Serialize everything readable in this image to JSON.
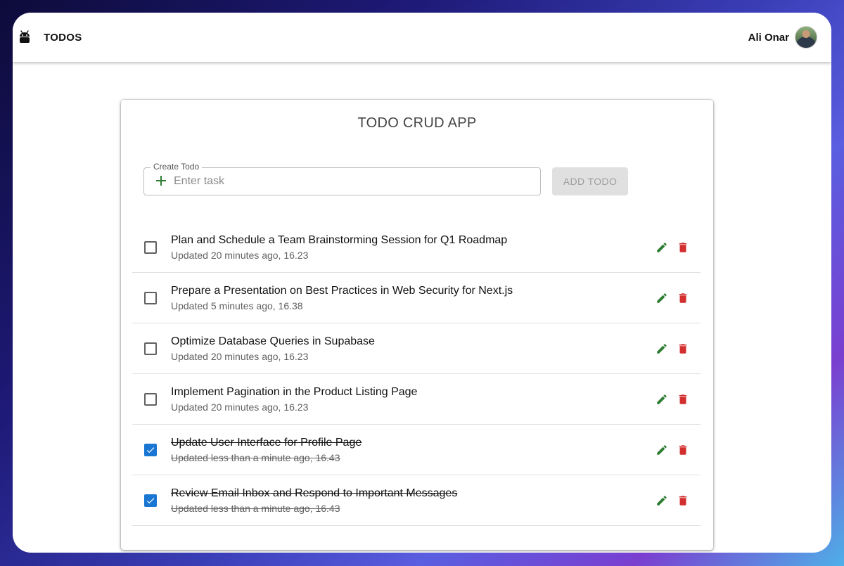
{
  "app": {
    "title": "TODOS",
    "user_name": "Ali Onar"
  },
  "card": {
    "title": "TODO CRUD APP"
  },
  "create": {
    "label": "Create Todo",
    "placeholder": "Enter task",
    "button_label": "ADD TODO"
  },
  "todos": [
    {
      "title": "Plan and Schedule a Team Brainstorming Session for Q1 Roadmap",
      "updated": "Updated 20 minutes ago, 16.23",
      "done": false
    },
    {
      "title": "Prepare a Presentation on Best Practices in Web Security for Next.js",
      "updated": "Updated 5 minutes ago, 16.38",
      "done": false
    },
    {
      "title": "Optimize Database Queries in Supabase",
      "updated": "Updated 20 minutes ago, 16.23",
      "done": false
    },
    {
      "title": "Implement Pagination in the Product Listing Page",
      "updated": "Updated 20 minutes ago, 16.23",
      "done": false
    },
    {
      "title": "Update User Interface for Profile Page",
      "updated": "Updated less than a minute ago, 16.43",
      "done": true
    },
    {
      "title": "Review Email Inbox and Respond to Important Messages",
      "updated": "Updated less than a minute ago, 16.43",
      "done": true
    }
  ],
  "colors": {
    "edit": "#2e7d32",
    "delete": "#d32f2f",
    "checked": "#1976d2"
  },
  "icons": {
    "app": "android-icon",
    "add": "plus-icon",
    "edit": "pencil-icon",
    "delete": "trash-icon",
    "checkbox": "checkbox-icon"
  }
}
